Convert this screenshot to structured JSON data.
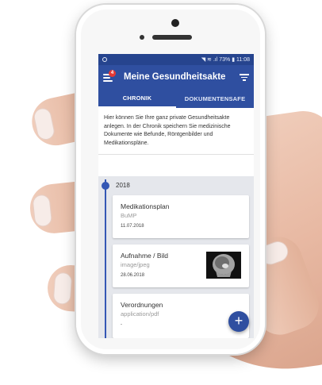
{
  "statusbar": {
    "right": "◥ ≋ .ıl 73% ▮ 11:08"
  },
  "appbar": {
    "badge": "4",
    "title": "Meine Gesundheitsakte"
  },
  "tabs": [
    {
      "label": "CHRONIK",
      "active": true
    },
    {
      "label": "DOKUMENTENSAFE",
      "active": false
    }
  ],
  "intro": "Hier können Sie Ihre ganz private Gesundheitsakte anlegen. In der Chronik speichern Sie medizinische Dokumente wie Befunde, Röntgenbilder und Medikationspläne.",
  "timeline": {
    "year": "2018",
    "cards": [
      {
        "title": "Medikationsplan",
        "subtitle": "BuMP",
        "date": "11.07.2018",
        "has_thumbnail": false
      },
      {
        "title": "Aufnahme / Bild",
        "subtitle": "image/jpeg",
        "date": "28.06.2018",
        "has_thumbnail": true
      },
      {
        "title": "Verordnungen",
        "subtitle": "application/pdf",
        "date": "-",
        "has_thumbnail": false
      }
    ]
  },
  "fab": {
    "icon": "plus-icon",
    "label": "+"
  },
  "colors": {
    "primary": "#2f4fa0",
    "statusbar": "#26448e",
    "timeline": "#3457b4",
    "badge": "#e53935"
  }
}
